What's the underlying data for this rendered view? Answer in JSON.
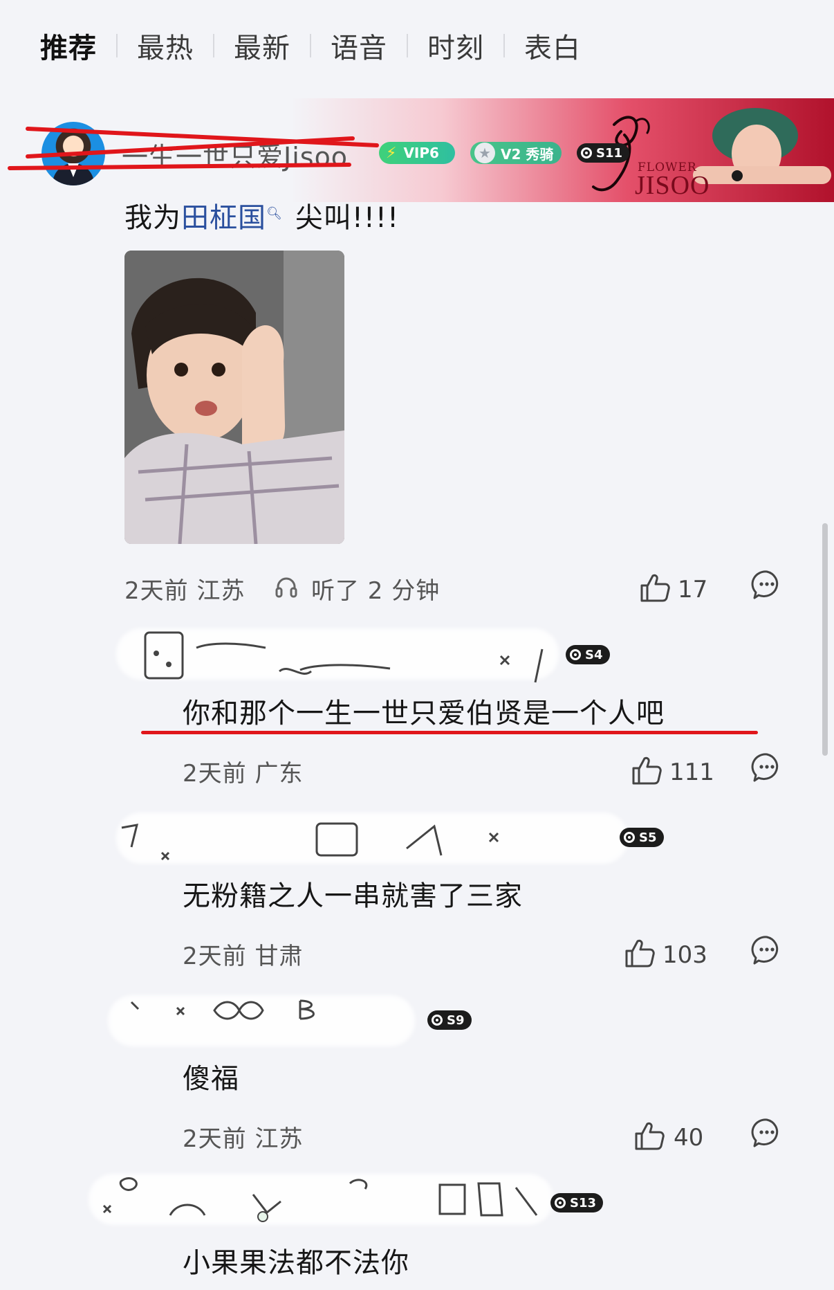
{
  "tabs": [
    "推荐",
    "最热",
    "最新",
    "语音",
    "时刻",
    "表白"
  ],
  "top_comment": {
    "username": "一生一世只爱Jisoo",
    "badges": {
      "vip": "VIP6",
      "v2": "V2 秀骑",
      "level": "S11"
    },
    "banner": {
      "flower": "FLOWER",
      "jisoo": "JISOO"
    },
    "text_prefix": "我为",
    "link": "田柾国",
    "text_suffix": "尖叫!!!!",
    "time": "2天前",
    "location": "江苏",
    "listened": "听了 2 分钟",
    "likes": "17"
  },
  "replies": [
    {
      "level": "S4",
      "text": "你和那个一生一世只爱伯贤是一个人吧",
      "time": "2天前",
      "location": "广东",
      "likes": "111"
    },
    {
      "level": "S5",
      "text": "无粉籍之人一串就害了三家",
      "time": "2天前",
      "location": "甘肃",
      "likes": "103"
    },
    {
      "level": "S9",
      "text": "傻福",
      "time": "2天前",
      "location": "江苏",
      "likes": "40"
    },
    {
      "level": "S13",
      "text": "小果果法都不法你"
    }
  ],
  "colors": {
    "accent_red": "#e0161b",
    "link_blue": "#2a4f9e",
    "vip_green": "#3fd17a"
  }
}
